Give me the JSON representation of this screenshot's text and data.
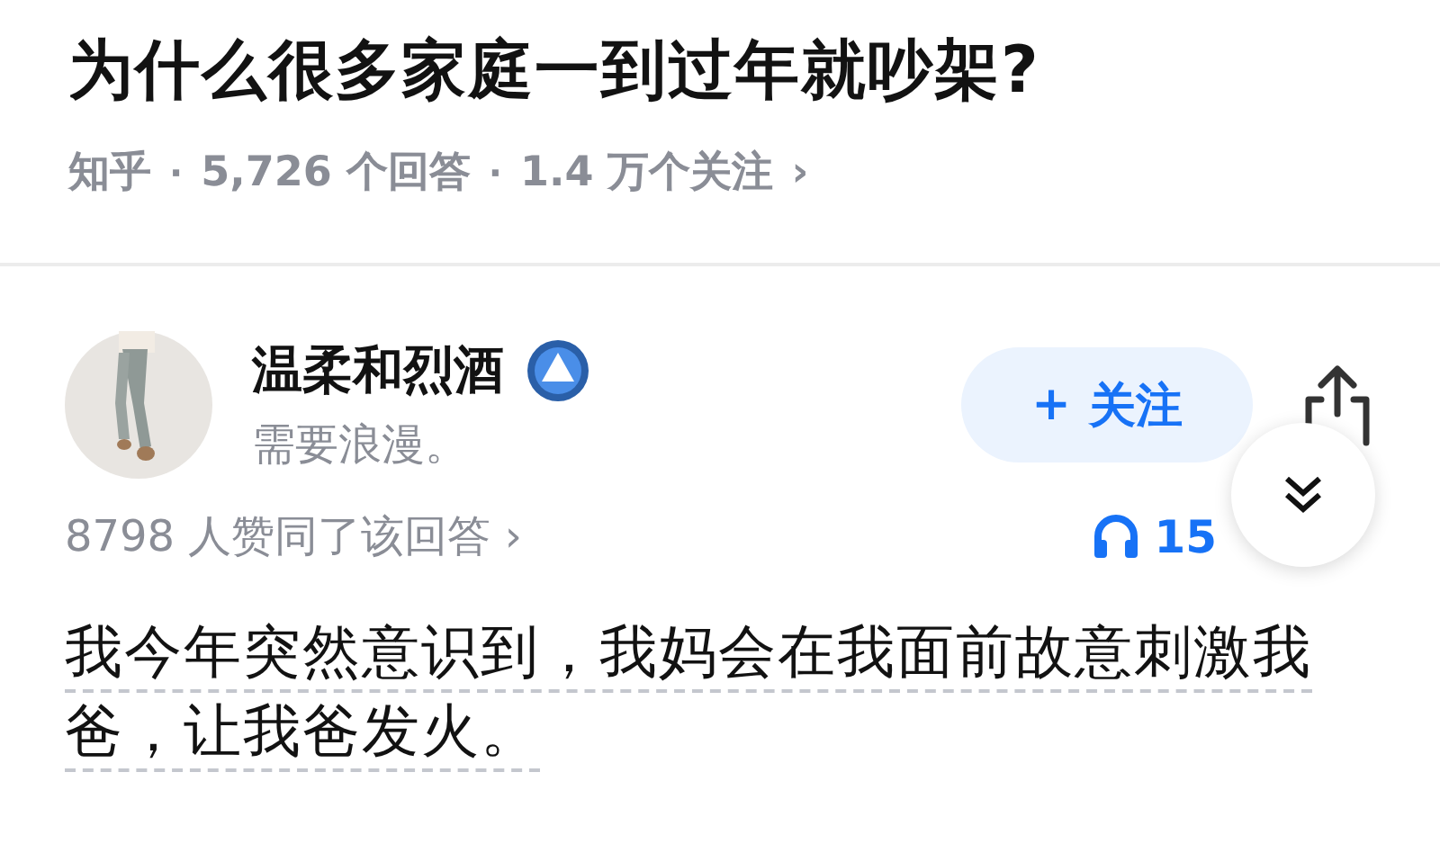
{
  "question": {
    "title": "为什么很多家庭一到过年就吵架?",
    "meta": [
      "知乎",
      "5,726 个回答",
      "1.4 万个关注"
    ],
    "meta_separator": "·",
    "meta_arrow": "›"
  },
  "author": {
    "name": "温柔和烈酒",
    "bio": "需要浪漫。",
    "follow_button": {
      "plus": "+",
      "label": "关注"
    }
  },
  "upvotes": {
    "text": "8798 人赞同了该回答",
    "arrow": "›"
  },
  "listeners": "15",
  "answer": "我今年突然意识到，我妈会在我面前故意刺激我爸，让我爸发火。"
}
